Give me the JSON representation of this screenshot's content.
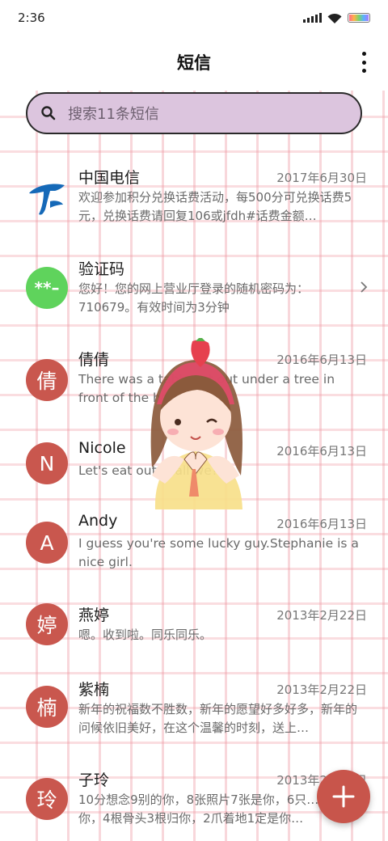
{
  "status_bar": {
    "time": "2:36"
  },
  "header": {
    "title": "短信"
  },
  "search": {
    "placeholder": "搜索11条短信"
  },
  "colors": {
    "avatar": "#c9574e",
    "verify_avatar": "#5fd35c",
    "telecom_logo": "#1569b8",
    "search_bg": "#dcc5de",
    "fab": "#c8554b"
  },
  "messages": [
    {
      "sender": "中国电信",
      "date": "2017年6月30日",
      "preview": "欢迎参加积分兑换话费活动，每500分可兑换话费5元，兑换话费请回复106或jfdh#话费金额…",
      "avatar_icon": "china-telecom-logo"
    },
    {
      "sender": "验证码",
      "date": "",
      "preview": "您好！您的网上营业厅登录的随机密码为：710679。有效时间为3分钟",
      "avatar_text": "**–"
    },
    {
      "sender": "倩倩",
      "date": "2016年6月13日",
      "preview": "There was a table set out under a tree in front of the hous",
      "avatar_text": "倩"
    },
    {
      "sender": "Nicole",
      "date": "2016年6月13日",
      "preview": "Let's eat out,shall we?",
      "avatar_text": "N"
    },
    {
      "sender": "Andy",
      "date": "2016年6月13日",
      "preview": "I guess you're some lucky guy.Stephanie is a nice girl.",
      "avatar_text": "A"
    },
    {
      "sender": "燕婷",
      "date": "2013年2月22日",
      "preview": "嗯。收到啦。同乐同乐。",
      "avatar_text": "婷"
    },
    {
      "sender": "紫楠",
      "date": "2013年2月22日",
      "preview": "新年的祝福数不胜数，新年的愿望好多好多，新年的问候依旧美好，在这个温馨的时刻，送上…",
      "avatar_text": "楠"
    },
    {
      "sender": "子玲",
      "date": "2013年2月22日",
      "preview": "10分想念9别的你，8张照片7张是你，6只…只像你，4根骨头3根归你，2爪着地1定是你…",
      "avatar_text": "玲"
    }
  ]
}
